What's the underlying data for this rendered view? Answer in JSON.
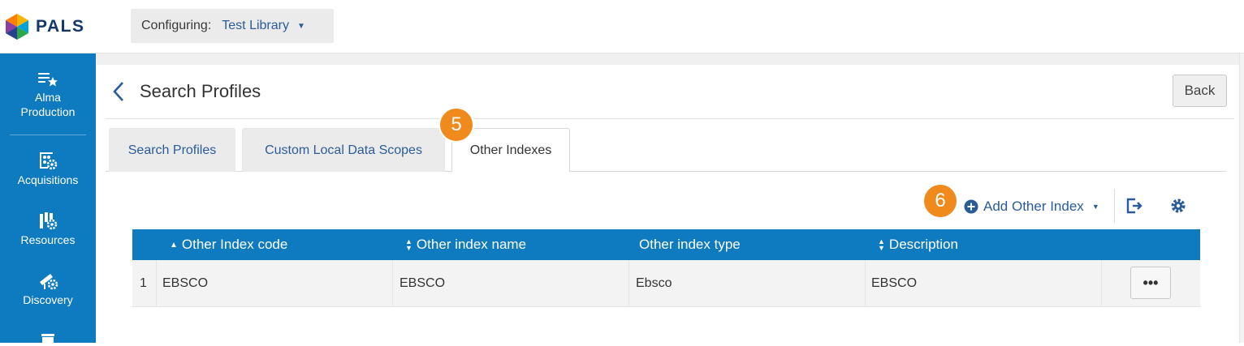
{
  "app": {
    "logo_text": "PALS"
  },
  "config": {
    "label": "Configuring:",
    "value": "Test Library"
  },
  "sidebar": {
    "items": [
      {
        "label_line1": "Alma",
        "label_line2": "Production",
        "icon": "list-star-icon"
      },
      {
        "label": "Acquisitions",
        "icon": "abacus-gear-icon"
      },
      {
        "label": "Resources",
        "icon": "books-gear-icon"
      },
      {
        "label": "Discovery",
        "icon": "telescope-gear-icon"
      }
    ]
  },
  "header": {
    "title": "Search Profiles",
    "back_label": "Back"
  },
  "tabs": [
    {
      "label": "Search Profiles",
      "active": false
    },
    {
      "label": "Custom Local Data Scopes",
      "active": false
    },
    {
      "label": "Other Indexes",
      "active": true
    }
  ],
  "badges": {
    "tabs_step": "5",
    "add_step": "6"
  },
  "toolbar": {
    "add_label": "Add Other Index"
  },
  "table": {
    "columns": [
      {
        "label": "Other Index code",
        "sort": "asc"
      },
      {
        "label": "Other index name",
        "sort": "both"
      },
      {
        "label": "Other index type",
        "sort": "none"
      },
      {
        "label": "Description",
        "sort": "both"
      }
    ],
    "rows": [
      {
        "index": "1",
        "code": "EBSCO",
        "name": "EBSCO",
        "type": "Ebsco",
        "description": "EBSCO",
        "actions_label": "•••"
      }
    ]
  },
  "colors": {
    "brand_blue": "#0e7ac0",
    "link_blue": "#2a5c9c",
    "badge_orange": "#f08a1c"
  }
}
